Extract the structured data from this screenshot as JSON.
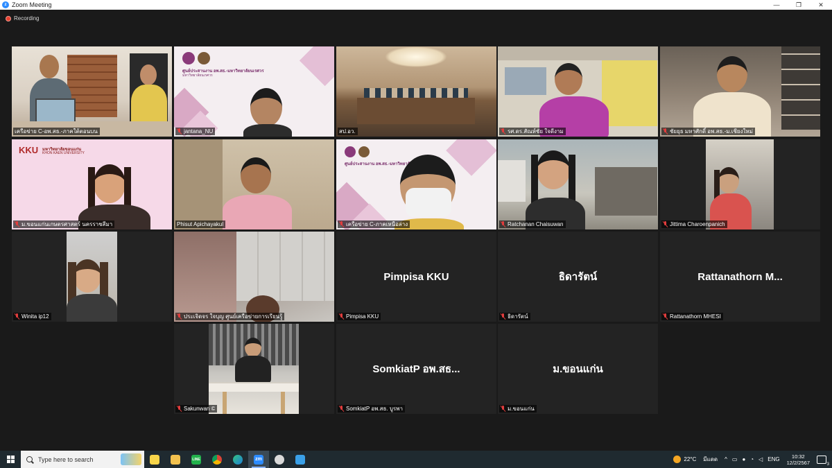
{
  "window": {
    "title": "Zoom Meeting",
    "minimize": "—",
    "maximize": "❐",
    "close": "✕"
  },
  "recording": {
    "label": "Recording"
  },
  "tiles": [
    {
      "name": "เครือข่าย C-อพ.สธ.-ภาคใต้ตอนบน",
      "video": true,
      "active": true
    },
    {
      "name": "jantana_NU",
      "video": true
    },
    {
      "name": "สป.อว.",
      "video": true
    },
    {
      "name": "รศ.ดร.สัณห์ชัย  ใจดีงาม",
      "video": true
    },
    {
      "name": "ชัยยุธ  มหาศักดิ์ อพ.สธ.-ม.เชียงใหม่",
      "video": true
    },
    {
      "name": "ม.ขอนแก่นเกษตรศาสตร์ นครราชสีมา",
      "video": true
    },
    {
      "name": "Phisut Apichayakul",
      "video": true
    },
    {
      "name": "เครือข่าย C-ภาคเหนือล่าง",
      "video": true
    },
    {
      "name": "Ratchanan Chaisuwan",
      "video": true
    },
    {
      "name": "Jittima Charoenpanich",
      "video": true
    },
    {
      "name": "Winita ip12",
      "video": true
    },
    {
      "name": "ประเจิดจร ใจบุญ ศูนย์เครือข่ายการเรียนรู้",
      "video": true
    },
    {
      "name": "Pimpisa KKU",
      "display": "Pimpisa KKU",
      "video": false
    },
    {
      "name": "ธิดารัตน์",
      "display": "ธิดารัตน์",
      "video": false
    },
    {
      "name": "Rattanathorn MHESI",
      "display": "Rattanathorn  M...",
      "video": false
    },
    {
      "name": "Sakunwan ©",
      "video": true
    },
    {
      "name": "SomkiatP อพ.สธ. บูรพา",
      "display": "SomkiatP อพ.สธ...",
      "video": false
    },
    {
      "name": "ม.ขอนแก่น",
      "display": "ม.ขอนแก่น",
      "video": false
    }
  ],
  "tile_banners": {
    "nu_center": "ศูนย์ประสานงาน อพ.สธ.-มหาวิทยาลัยนเรศวร",
    "nu_sub": "มหาวิทยาลัยนเรศวร",
    "kku_logo": "KKU",
    "kku_thai": "มหาวิทยาลัยขอนแก่น",
    "kku_en": "KHON KAEN UNIVERSITY",
    "nu_center_2": "ศูนย์ประสานงาน อพ.สธ.-มหาวิทยาลัย"
  },
  "taskbar": {
    "search_placeholder": "Type here to search",
    "apps": [
      "sticky-notes",
      "file-explorer",
      "line",
      "chrome",
      "edge",
      "zoom",
      "unknown-app",
      "photos"
    ],
    "zoom_label": "zm",
    "line_label": "LINE",
    "weather": "22°C",
    "weather_desc": "มีแดด",
    "language": "ENG",
    "time": "10:32",
    "date": "12/2/2567"
  }
}
